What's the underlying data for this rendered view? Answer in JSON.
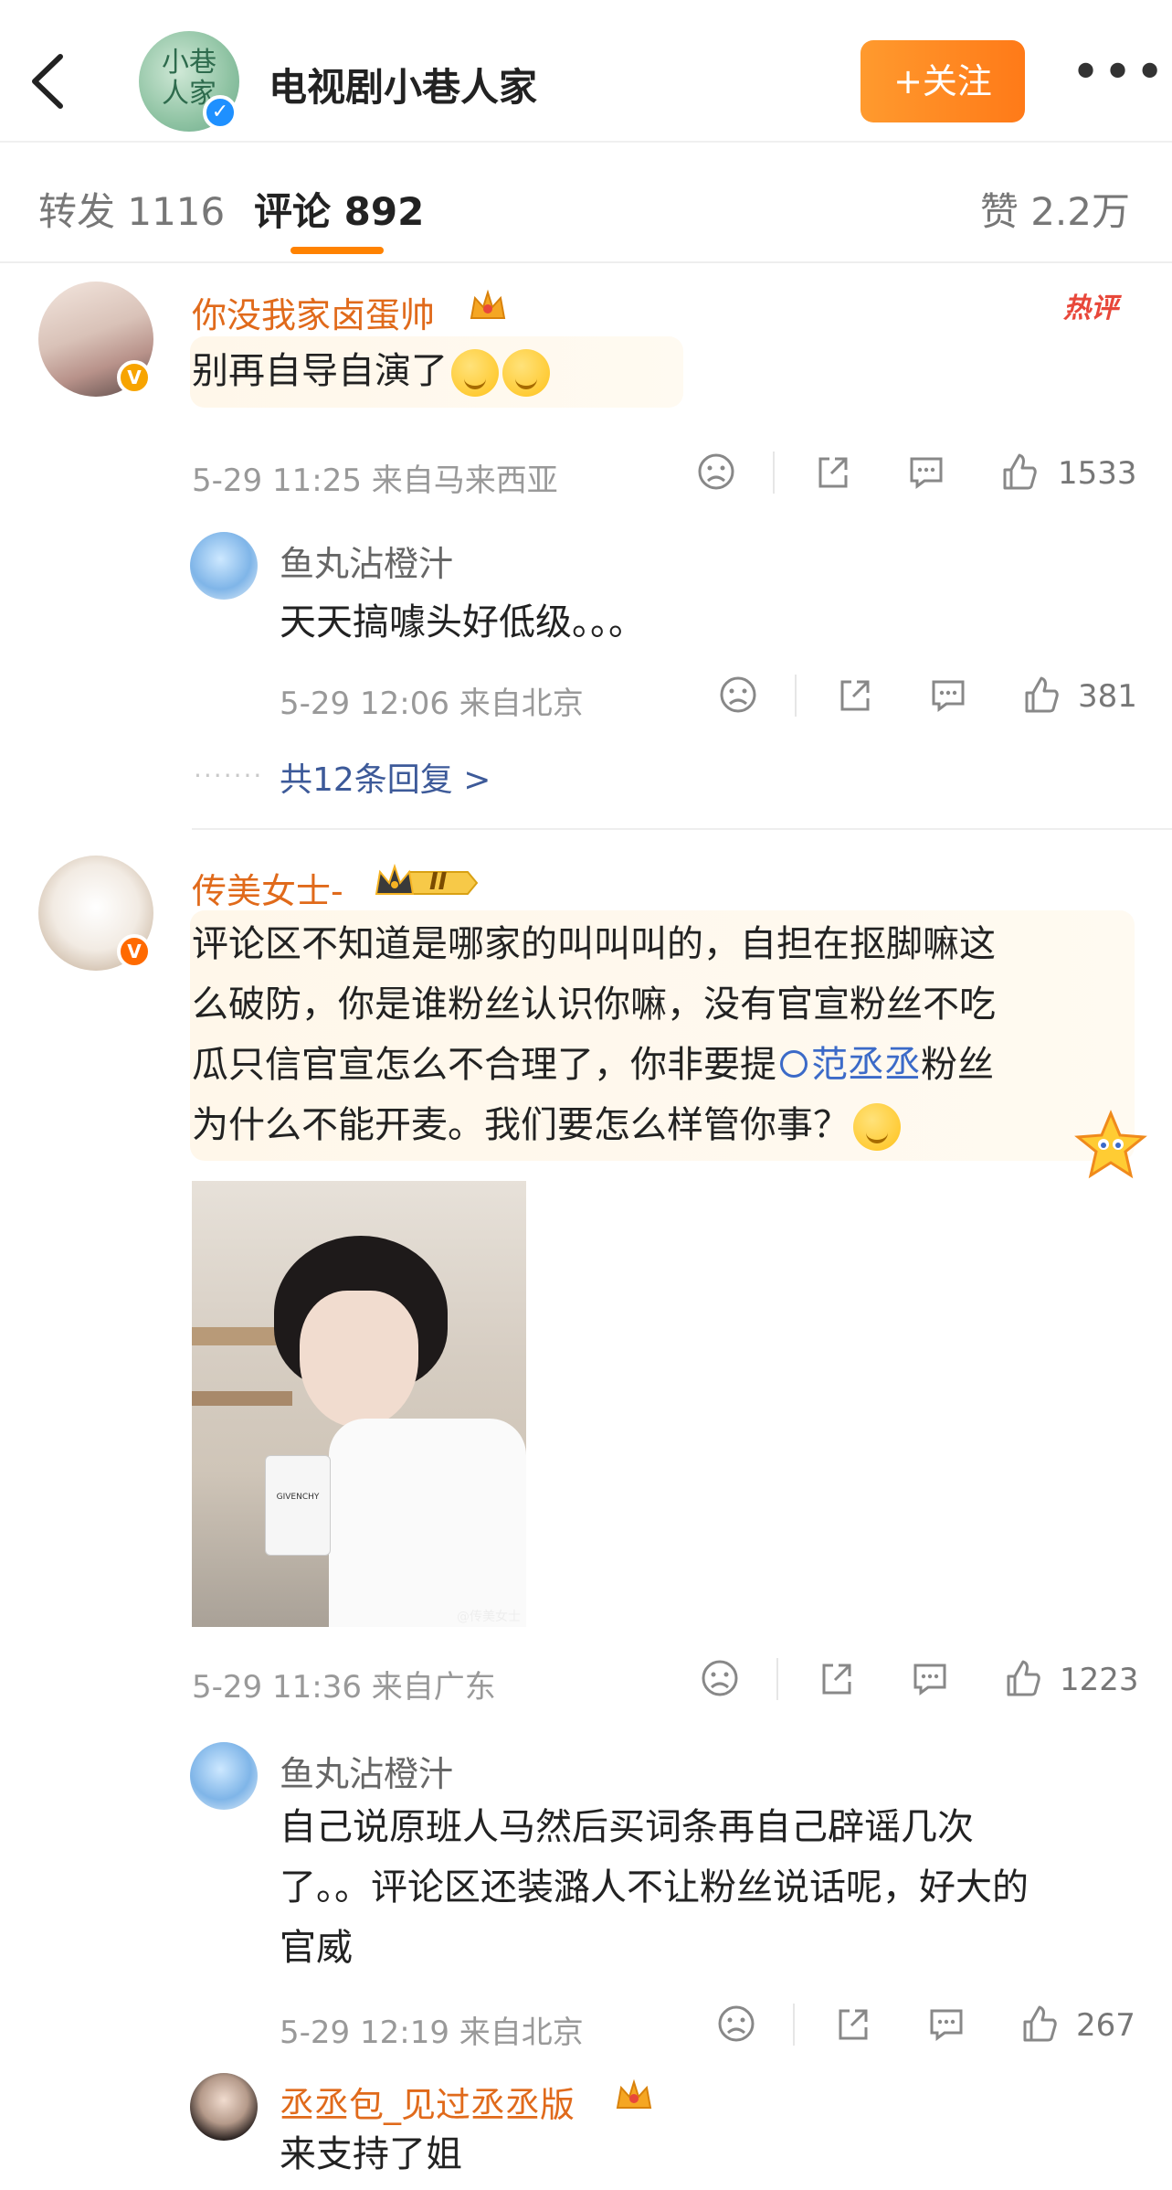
{
  "header": {
    "page_title": "电视剧小巷人家",
    "avatar_text": "小巷人家",
    "follow_label": "+关注",
    "more_label": "•••"
  },
  "tabs": {
    "repost": "转发 1116",
    "comment": "评论 892",
    "like": "赞 2.2万"
  },
  "comments": [
    {
      "username": "你没我家卤蛋帅",
      "text": "别再自导自演了",
      "hot_label": "热评",
      "meta": "5-29 11:25 来自马来西亚",
      "like_count": "1533",
      "replies": [
        {
          "username": "鱼丸沾橙汁",
          "text": "天天搞噱头好低级。。。",
          "meta": "5-29 12:06 来自北京",
          "like_count": "381"
        }
      ],
      "more_replies": "共12条回复 >"
    },
    {
      "username": "传美女士-",
      "level_badge": "II",
      "text_lines": [
        "评论区不知道是哪家的叫叫叫的，自担在抠脚嘛这",
        "么破防，你是谁粉丝认识你嘛，没有官宣粉丝不吃",
        "瓜只信官宣怎么不合理了，你非要提",
        "粉丝",
        "为什么不能开麦。我们要怎么样管你事？"
      ],
      "topic": "范丞丞",
      "photo_watermark": "@传美女士",
      "cup_text": "GIVENCHY",
      "meta": "5-29 11:36 来自广东",
      "like_count": "1223",
      "replies": [
        {
          "username": "鱼丸沾橙汁",
          "text_lines": [
            "自己说原班人马然后买词条再自己辟谣几次",
            "了。。评论区还装潞人不让粉丝说话呢，好大的",
            "官威"
          ],
          "meta": "5-29 12:19 来自北京",
          "like_count": "267"
        },
        {
          "username": "丞丞包_见过丞丞版",
          "text": "来支持了姐"
        }
      ]
    }
  ],
  "colors": {
    "accent": "#ff8200",
    "username": "#e06a1b",
    "link": "#3b6ac8"
  },
  "icons": [
    "back-icon",
    "verified-icon",
    "more-icon",
    "dislike-icon",
    "share-icon",
    "comment-icon",
    "like-icon"
  ]
}
